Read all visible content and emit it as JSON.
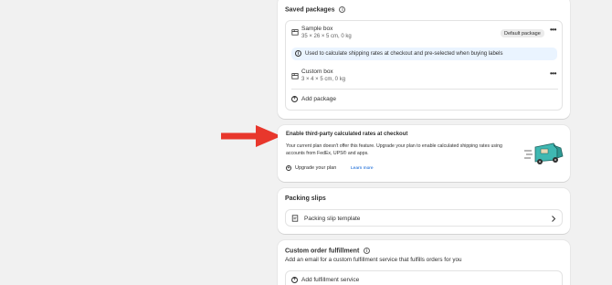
{
  "saved_packages": {
    "title": "Saved packages",
    "packages": [
      {
        "name": "Sample box",
        "dims": "35 × 26 × 5 cm, 0 kg",
        "badge": "Default package"
      },
      {
        "name": "Custom box",
        "dims": "3 × 4 × 5 cm, 0 kg"
      }
    ],
    "banner_text": "Used to calculate shipping rates at checkout and pre-selected when buying labels",
    "add_label": "Add package"
  },
  "third_party": {
    "title": "Enable third-party calculated rates at checkout",
    "description_line1": "Your current plan doesn't offer this feature. Upgrade your plan to enable calculated shipping rates using",
    "description_line2": "accounts from FedEx, UPS® and apps.",
    "upgrade_label": "Upgrade your plan",
    "learn_more": "Learn more"
  },
  "packing_slips": {
    "title": "Packing slips",
    "template_label": "Packing slip template"
  },
  "custom_fulfillment": {
    "title": "Custom order fulfillment",
    "description": "Add an email for a custom fulfillment service that fulfills orders for you",
    "add_label": "Add fulfillment service"
  },
  "colors": {
    "arrow": "#e8372c",
    "info_banner": "#eaf4ff",
    "link": "#005bd3"
  },
  "icons": [
    "info-icon",
    "package-icon",
    "more-icon",
    "plus-circle-icon",
    "arrow-icon",
    "truck-illustration",
    "document-icon",
    "chevron-right-icon"
  ]
}
